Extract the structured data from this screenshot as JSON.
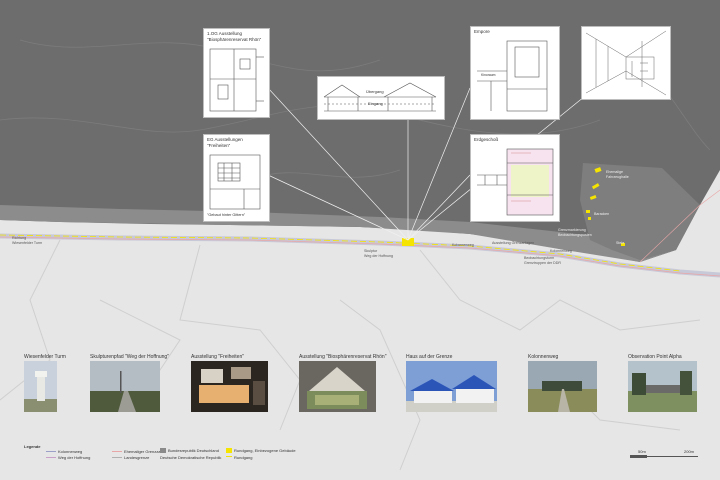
{
  "colors": {
    "plateau": "#6e6e6e",
    "plateau_light": "#8a8a8a",
    "ground": "#e6e6e6",
    "border_strip": "#c9cad6",
    "highlight": "#f5e400",
    "route_line": "#e9a6a6",
    "sightline": "#ffffff"
  },
  "panels": {
    "og": {
      "title": "1.OG Ausstellung",
      "subtitle": "\"Biosphärenreservat Rhön\""
    },
    "section": {
      "label1": "Übergang",
      "label2": "Eingang"
    },
    "empore": {
      "title": "Empore",
      "note": "Kinoraum"
    },
    "eg": {
      "title": "EG Ausstellungen",
      "subtitle": "\"Freiheiten\"",
      "caption": "\"Gebaut hinter Gittern\""
    },
    "erdgeschoss": {
      "title": "Erdgeschoß"
    }
  },
  "site_labels": {
    "richtung1": "Richtung",
    "richtung2": "Wiesenfelder Turm",
    "skulptur1": "Skulptur",
    "skulptur2": "Weg der Hoffnung",
    "kolonnenweg_a": "Kolonnenweg",
    "kolonnenweg_b": "Kolonnenweg",
    "ausstellung_grenze": "Ausstellung Grenzanlagen",
    "beobachtung1": "Beobachtungsturm",
    "beobachtung2": "Grenztruppen der DDR",
    "grenze_usa1": "Grenzmarkierung",
    "grenze_usa2": "Beobachtungsposten",
    "ehemalige1": "Ehemalige",
    "ehemalige2": "Fahrzeughalle",
    "baracken": "Baracken",
    "stele": "Stele"
  },
  "photos": [
    {
      "caption": "Wiesenfelder Turm"
    },
    {
      "caption": "Skulpturenpfad \"Weg der Hoffnung\""
    },
    {
      "caption": "Ausstellung \"Freiheiten\""
    },
    {
      "caption": "Ausstellung \"Biosphärenreservat Rhön\""
    },
    {
      "caption": "Haus auf der Grenze"
    },
    {
      "caption": "Kolonnenweg"
    },
    {
      "caption": "Observation Point Alpha"
    }
  ],
  "legend": {
    "title": "Legende",
    "kolonnenweg": "Kolonnenweg",
    "weg_hoffnung": "Weg der Hoffnung",
    "grenzzaun": "Ehemaliger Grenzzaun",
    "landesgrenze": "Landesgrenze",
    "brd": "Bundesrepublik Deutschland",
    "ddr": "Deutsche Demokratische Republik",
    "rundgang_gebaeude": "Rundgang, Einbezogene Gebäude",
    "rundgang": "Rundgang"
  },
  "scale": {
    "a": "50m",
    "b": "200m"
  }
}
